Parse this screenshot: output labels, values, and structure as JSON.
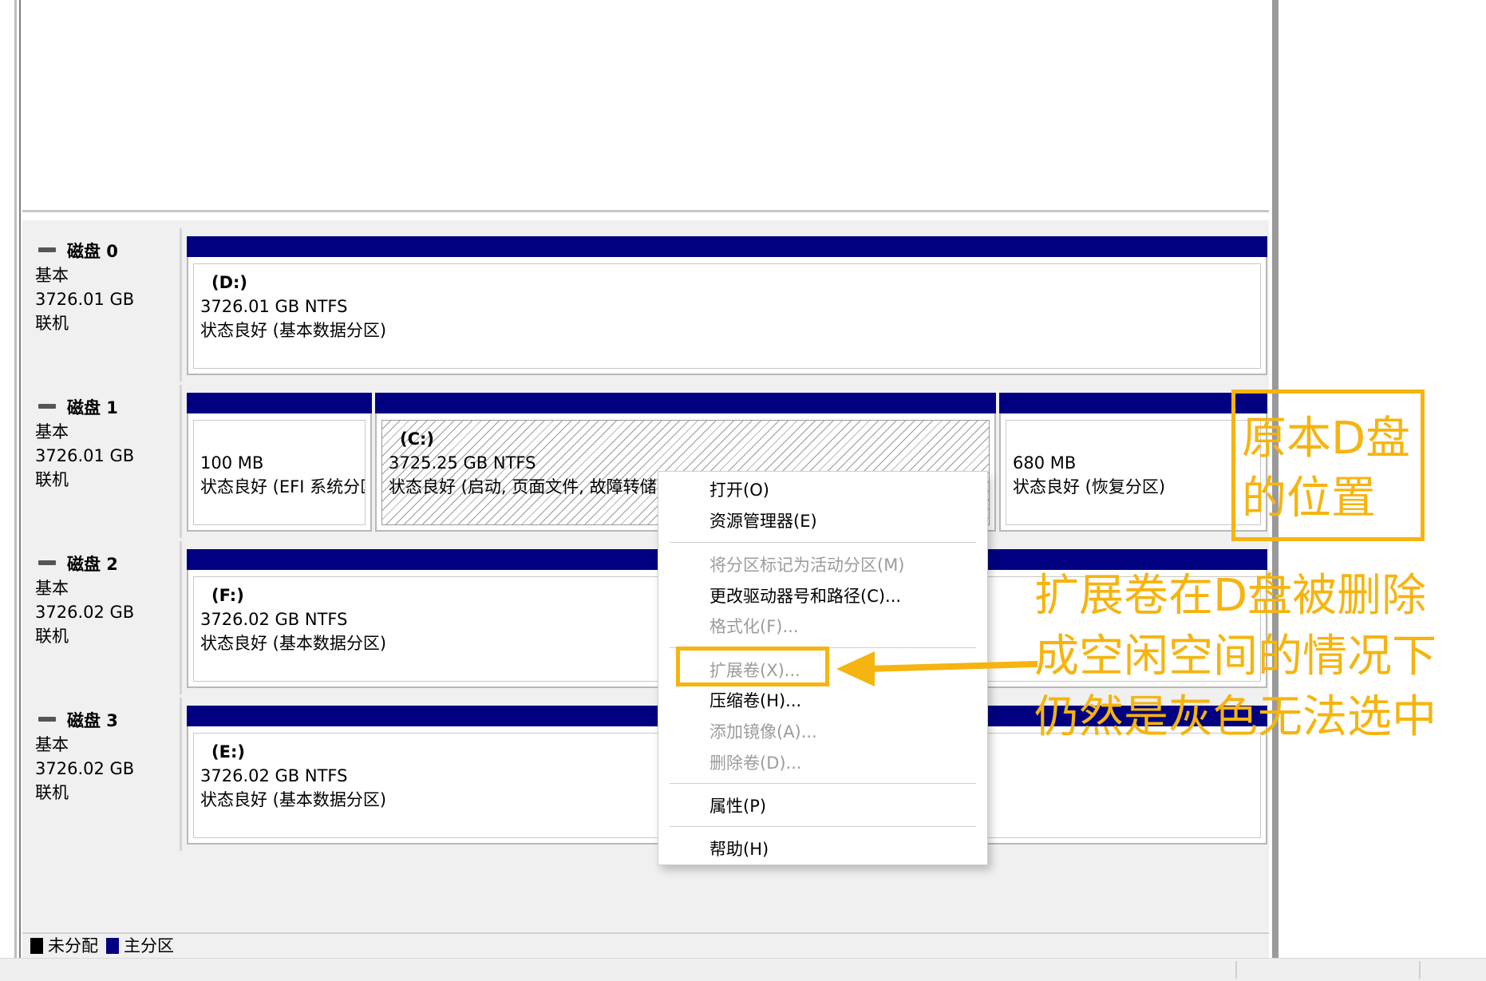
{
  "disks": [
    {
      "name": "磁盘 0",
      "type": "基本",
      "size": "3726.01 GB",
      "status": "联机",
      "volumes": [
        {
          "label": "(D:)",
          "size": "3726.01 GB NTFS",
          "status": "状态良好 (基本数据分区)"
        }
      ]
    },
    {
      "name": "磁盘 1",
      "type": "基本",
      "size": "3726.01 GB",
      "status": "联机",
      "volumes": [
        {
          "label": "",
          "size": "100 MB",
          "status": "状态良好 (EFI 系统分区"
        },
        {
          "label": "(C:)",
          "size": "3725.25 GB NTFS",
          "status": "状态良好 (启动, 页面文件, 故障转储,"
        },
        {
          "label": "",
          "size": "680 MB",
          "status": "状态良好 (恢复分区)"
        }
      ]
    },
    {
      "name": "磁盘 2",
      "type": "基本",
      "size": "3726.02 GB",
      "status": "联机",
      "volumes": [
        {
          "label": "(F:)",
          "size": "3726.02 GB NTFS",
          "status": "状态良好 (基本数据分区)"
        }
      ]
    },
    {
      "name": "磁盘 3",
      "type": "基本",
      "size": "3726.02 GB",
      "status": "联机",
      "volumes": [
        {
          "label": "(E:)",
          "size": "3726.02 GB NTFS",
          "status": "状态良好 (基本数据分区)"
        }
      ]
    }
  ],
  "context_menu": {
    "items": [
      {
        "label": "打开(O)",
        "enabled": true
      },
      {
        "label": "资源管理器(E)",
        "enabled": true
      },
      {
        "label": "将分区标记为活动分区(M)",
        "enabled": false
      },
      {
        "label": "更改驱动器号和路径(C)...",
        "enabled": true
      },
      {
        "label": "格式化(F)...",
        "enabled": false
      },
      {
        "label": "扩展卷(X)...",
        "enabled": false
      },
      {
        "label": "压缩卷(H)...",
        "enabled": true
      },
      {
        "label": "添加镜像(A)...",
        "enabled": false
      },
      {
        "label": "删除卷(D)...",
        "enabled": false
      },
      {
        "label": "属性(P)",
        "enabled": true
      },
      {
        "label": "帮助(H)",
        "enabled": true
      }
    ]
  },
  "legend": {
    "unallocated": "未分配",
    "primary": "主分区"
  },
  "annotations": {
    "box_note_line1": "原本D盘",
    "box_note_line2": "的位置",
    "arrow_note_line1": "扩展卷在D盘被删除",
    "arrow_note_line2": "成空闲空间的情况下",
    "arrow_note_line3": "仍然是灰色无法选中"
  },
  "colors": {
    "primary_partition": "#000080",
    "unallocated": "#000000",
    "annotation": "#f5b40f",
    "disabled_text": "#9c9c9c"
  }
}
